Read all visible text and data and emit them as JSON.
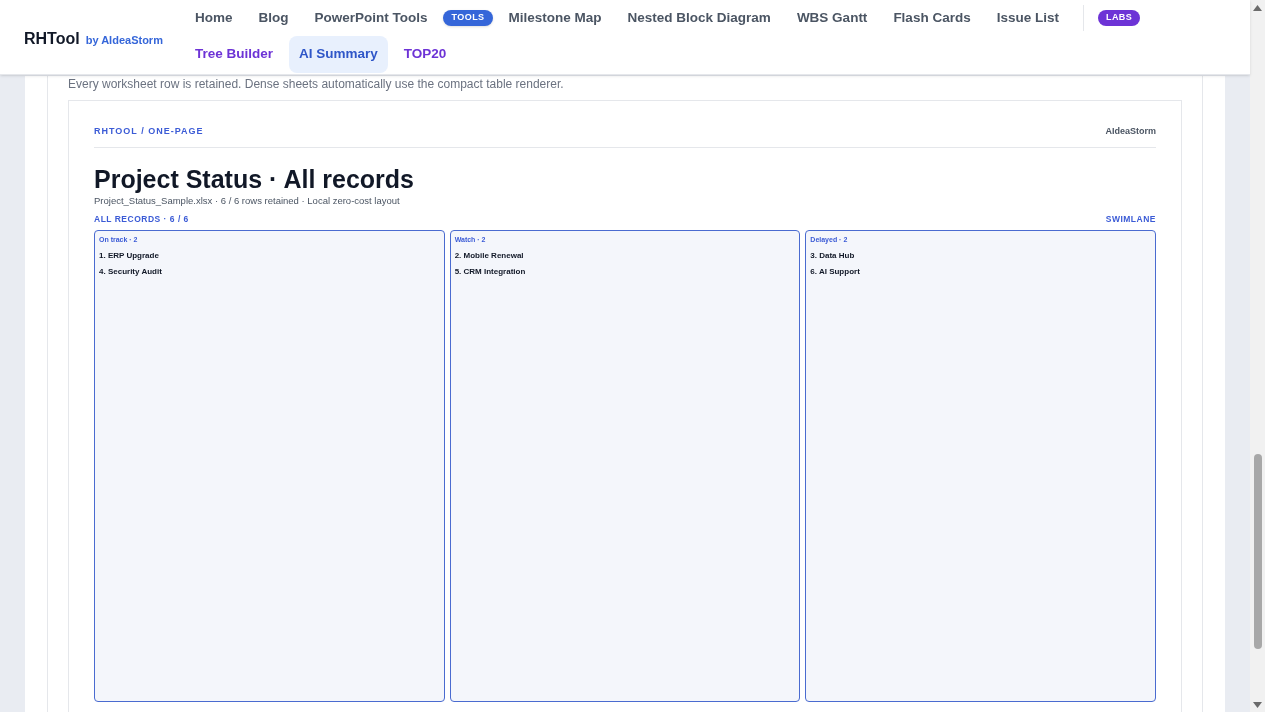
{
  "brand": {
    "name": "RHTool",
    "byline": "by AIdeaStorm"
  },
  "nav": [
    {
      "label": "Home",
      "kind": "link",
      "selected": false
    },
    {
      "label": "Blog",
      "kind": "link",
      "selected": false
    },
    {
      "label": "PowerPoint Tools",
      "kind": "link",
      "selected": false
    },
    {
      "label": "TOOLS",
      "kind": "tools-badge",
      "selected": false
    },
    {
      "label": "Milestone Map",
      "kind": "link",
      "selected": false
    },
    {
      "label": "Nested Block Diagram",
      "kind": "link",
      "selected": false
    },
    {
      "label": "WBS Gantt",
      "kind": "link",
      "selected": false
    },
    {
      "label": "Flash Cards",
      "kind": "link",
      "selected": false
    },
    {
      "label": "Issue List",
      "kind": "link",
      "selected": false
    },
    {
      "label": "LABS",
      "kind": "labs-badge",
      "selected": false
    },
    {
      "label": "Tree Builder",
      "kind": "lab-link",
      "selected": false
    },
    {
      "label": "AI Summary",
      "kind": "lab-link",
      "selected": true
    },
    {
      "label": "TOP20",
      "kind": "lab-link",
      "selected": false
    }
  ],
  "note": "Every worksheet row is retained. Dense sheets automatically use the compact table renderer.",
  "document": {
    "breadcrumb": "RHTOOL / ONE-PAGE",
    "author": "AIdeaStorm",
    "title": "Project Status · All records",
    "subtitle": "Project_Status_Sample.xlsx · 6 / 6 rows retained · Local zero-cost layout",
    "section": "ALL RECORDS · 6 / 6",
    "view": "SWIMLANE",
    "lanes": [
      {
        "title": "On track · 2",
        "items": [
          "1. ERP Upgrade",
          "4. Security Audit"
        ]
      },
      {
        "title": "Watch · 2",
        "items": [
          "2. Mobile Renewal",
          "5. CRM Integration"
        ]
      },
      {
        "title": "Delayed · 2",
        "items": [
          "3. Data Hub",
          "6. AI Support"
        ]
      }
    ]
  }
}
